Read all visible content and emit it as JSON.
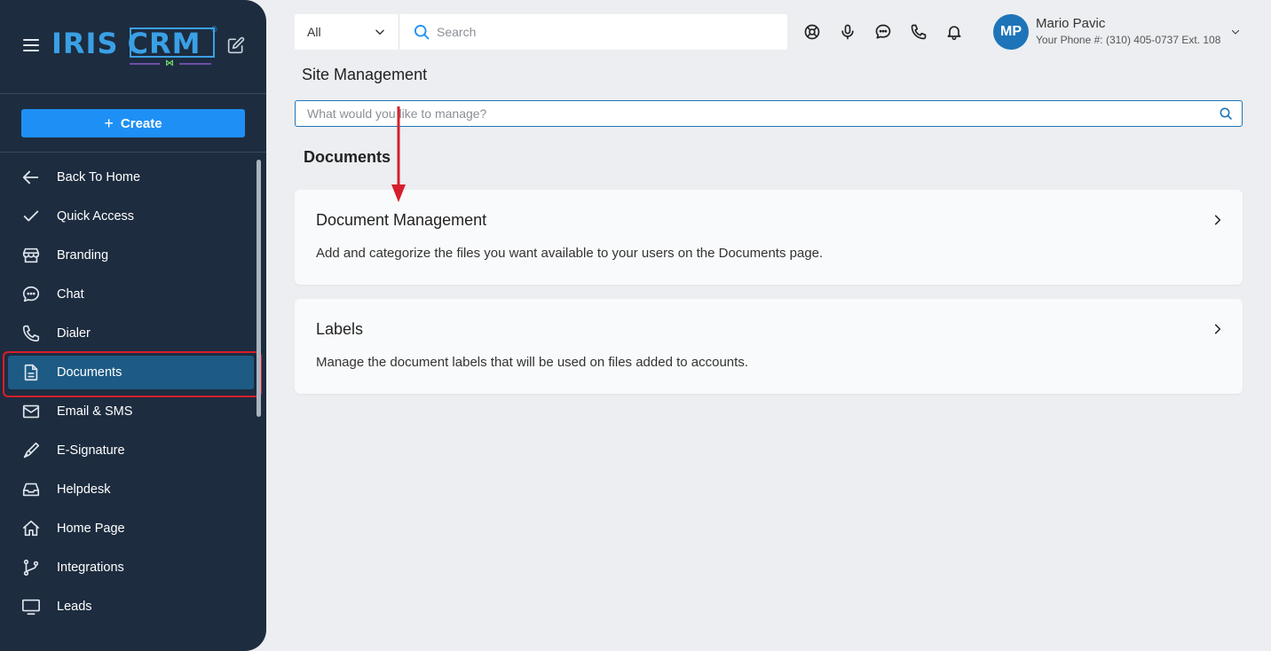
{
  "sidebar": {
    "logo": {
      "brand": "IRIS",
      "product": "CRM",
      "reg": "®"
    },
    "create_label": "Create",
    "items": [
      {
        "label": "Back To Home",
        "icon": "arrow-left-icon"
      },
      {
        "label": "Quick Access",
        "icon": "check-icon"
      },
      {
        "label": "Branding",
        "icon": "store-icon"
      },
      {
        "label": "Chat",
        "icon": "chat-icon"
      },
      {
        "label": "Dialer",
        "icon": "phone-icon"
      },
      {
        "label": "Documents",
        "icon": "document-icon",
        "active": true
      },
      {
        "label": "Email & SMS",
        "icon": "mail-icon"
      },
      {
        "label": "E-Signature",
        "icon": "pen-icon"
      },
      {
        "label": "Helpdesk",
        "icon": "inbox-icon"
      },
      {
        "label": "Home Page",
        "icon": "home-icon"
      },
      {
        "label": "Integrations",
        "icon": "git-branch-icon"
      },
      {
        "label": "Leads",
        "icon": "monitor-icon"
      }
    ]
  },
  "topbar": {
    "scope_value": "All",
    "search_placeholder": "Search",
    "icons": [
      "lifebuoy-icon",
      "microphone-icon",
      "chat-icon",
      "phone-icon",
      "bell-icon"
    ]
  },
  "user": {
    "initials": "MP",
    "name": "Mario Pavic",
    "phone": "Your Phone #: (310) 405-0737 Ext. 108"
  },
  "main": {
    "title": "Site Management",
    "manage_placeholder": "What would you like to manage?",
    "section": "Documents",
    "cards": [
      {
        "title": "Document Management",
        "description": "Add and categorize the files you want available to your users on the Documents page."
      },
      {
        "title": "Labels",
        "description": "Manage the document labels that will be used on files added to accounts."
      }
    ]
  },
  "colors": {
    "sidebar_bg": "#1d2c3f",
    "accent": "#1e90f5",
    "active_bg": "#1d5b85",
    "highlight": "#d61f2c",
    "page_bg": "#eceef1"
  }
}
